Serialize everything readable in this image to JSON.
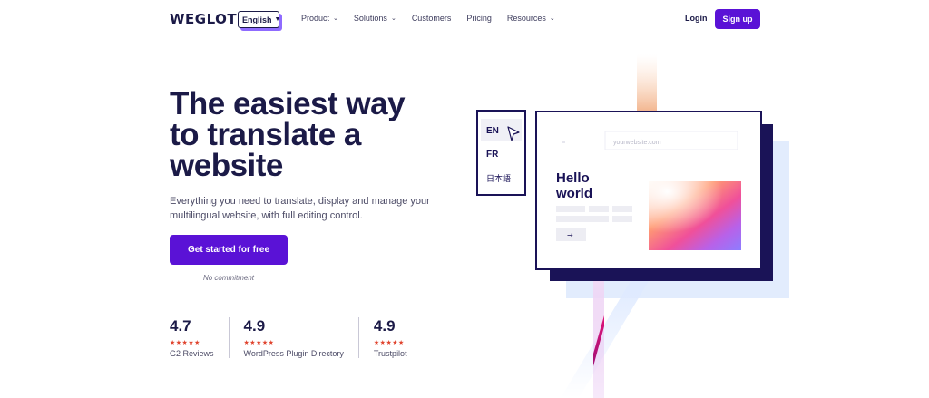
{
  "nav": {
    "logo": "WEGLOT",
    "language": "English",
    "menu": [
      {
        "label": "Product",
        "has_dropdown": true
      },
      {
        "label": "Solutions",
        "has_dropdown": true
      },
      {
        "label": "Customers",
        "has_dropdown": false
      },
      {
        "label": "Pricing",
        "has_dropdown": false
      },
      {
        "label": "Resources",
        "has_dropdown": true
      }
    ],
    "login": "Login",
    "signup": "Sign up"
  },
  "hero": {
    "headline": "The easiest way to translate a website",
    "subtitle": "Everything you need to translate, display and manage your multilingual website, with full editing control.",
    "cta": "Get started for free",
    "no_commitment": "No commitment"
  },
  "ratings": [
    {
      "score": "4.7",
      "stars": 5,
      "label": "G2 Reviews"
    },
    {
      "score": "4.9",
      "stars": 5,
      "label": "WordPress Plugin Directory"
    },
    {
      "score": "4.9",
      "stars": 5,
      "label": "Trustpilot"
    }
  ],
  "illustration": {
    "languages": [
      "EN",
      "FR",
      "日本語"
    ],
    "url_placeholder": "yourwebsite.com",
    "mock_heading": "Hello world",
    "mock_button_icon": "arrow-right-icon"
  },
  "colors": {
    "brand": "#5a12d6",
    "navy": "#1b1a47",
    "star": "#e0442e",
    "light_blue": "#dfeaff"
  }
}
